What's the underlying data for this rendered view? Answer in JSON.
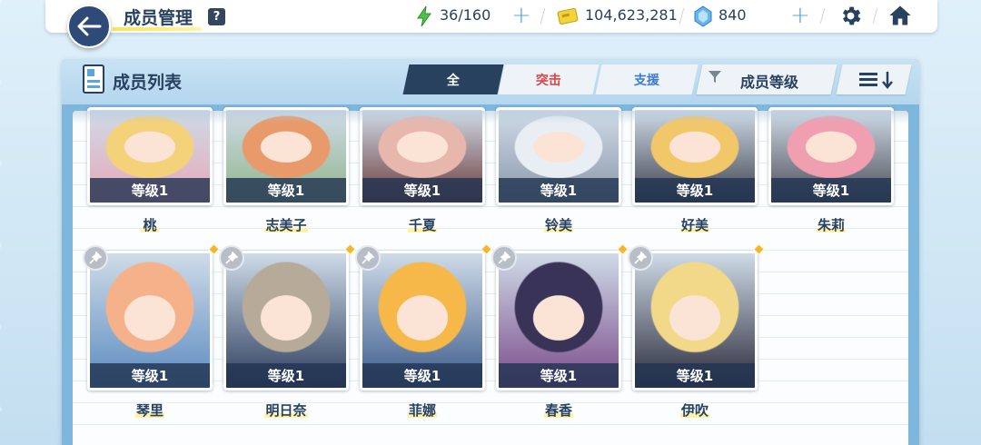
{
  "header": {
    "title": "成员管理",
    "help": "?",
    "ap": "36/160",
    "credits": "104,623,281",
    "gems": "840"
  },
  "panel": {
    "title": "成员列表",
    "tabs": [
      "全",
      "突击",
      "支援"
    ],
    "sort_label": "成员等级"
  },
  "members": [
    {
      "name": "桃",
      "level": "等级1",
      "colors": [
        "#f3d27a",
        "#e8a7b8"
      ]
    },
    {
      "name": "志美子",
      "level": "等级1",
      "colors": [
        "#e89a6a",
        "#8fb48a"
      ]
    },
    {
      "name": "千夏",
      "level": "等级1",
      "colors": [
        "#e7b7ae",
        "#6a3a3a"
      ]
    },
    {
      "name": "铃美",
      "level": "等级1",
      "colors": [
        "#e9eef4",
        "#8a97a8"
      ]
    },
    {
      "name": "好美",
      "level": "等级1",
      "colors": [
        "#f2c76a",
        "#3b3f4a"
      ]
    },
    {
      "name": "朱莉",
      "level": "等级1",
      "colors": [
        "#ef9fb0",
        "#4a4b55"
      ]
    },
    {
      "name": "琴里",
      "level": "等级1",
      "colors": [
        "#f5b28a",
        "#5b8bc0"
      ]
    },
    {
      "name": "明日奈",
      "level": "等级1",
      "colors": [
        "#b6aa98",
        "#2c3c5c"
      ]
    },
    {
      "name": "菲娜",
      "level": "等级1",
      "colors": [
        "#f6b848",
        "#3a5a8a"
      ]
    },
    {
      "name": "春香",
      "level": "等级1",
      "colors": [
        "#3a3358",
        "#7a4a8a"
      ]
    },
    {
      "name": "伊吹",
      "level": "等级1",
      "colors": [
        "#f2d98a",
        "#2a2a3a"
      ]
    }
  ]
}
